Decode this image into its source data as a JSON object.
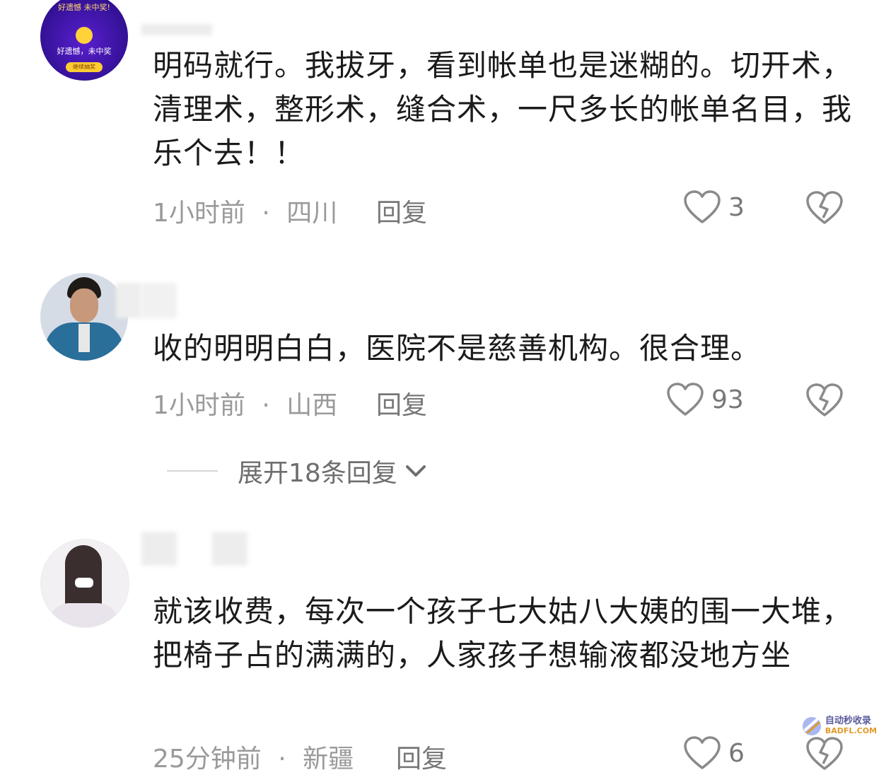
{
  "comments": [
    {
      "text": "明码就行。我拔牙，看到帐单也是迷糊的。切开术，清理术，整形术，缝合术，一尺多长的帐单名目，我乐个去！！",
      "time": "1小时前",
      "location": "四川",
      "reply_label": "回复",
      "likes": "3",
      "avatar": {
        "top_text": "好遗憾 未中奖!",
        "mid_text": "好遗憾，未中奖",
        "button_text": "继续抽奖"
      }
    },
    {
      "text": "收的明明白白，医院不是慈善机构。很合理。",
      "time": "1小时前",
      "location": "山西",
      "reply_label": "回复",
      "likes": "93",
      "expand_label": "展开18条回复"
    },
    {
      "text": "就该收费，每次一个孩子七大姑八大姨的围一大堆，把椅子占的满满的，人家孩子想输液都没地方坐",
      "time": "25分钟前",
      "location": "新疆",
      "reply_label": "回复",
      "likes": "6"
    }
  ],
  "separator": "·",
  "watermark": {
    "cn": "自动秒收录",
    "en": "BADFL.COM"
  },
  "colors": {
    "text": "#1b1b1b",
    "meta": "#9a9a9a",
    "accent": "#4b1fa8"
  }
}
